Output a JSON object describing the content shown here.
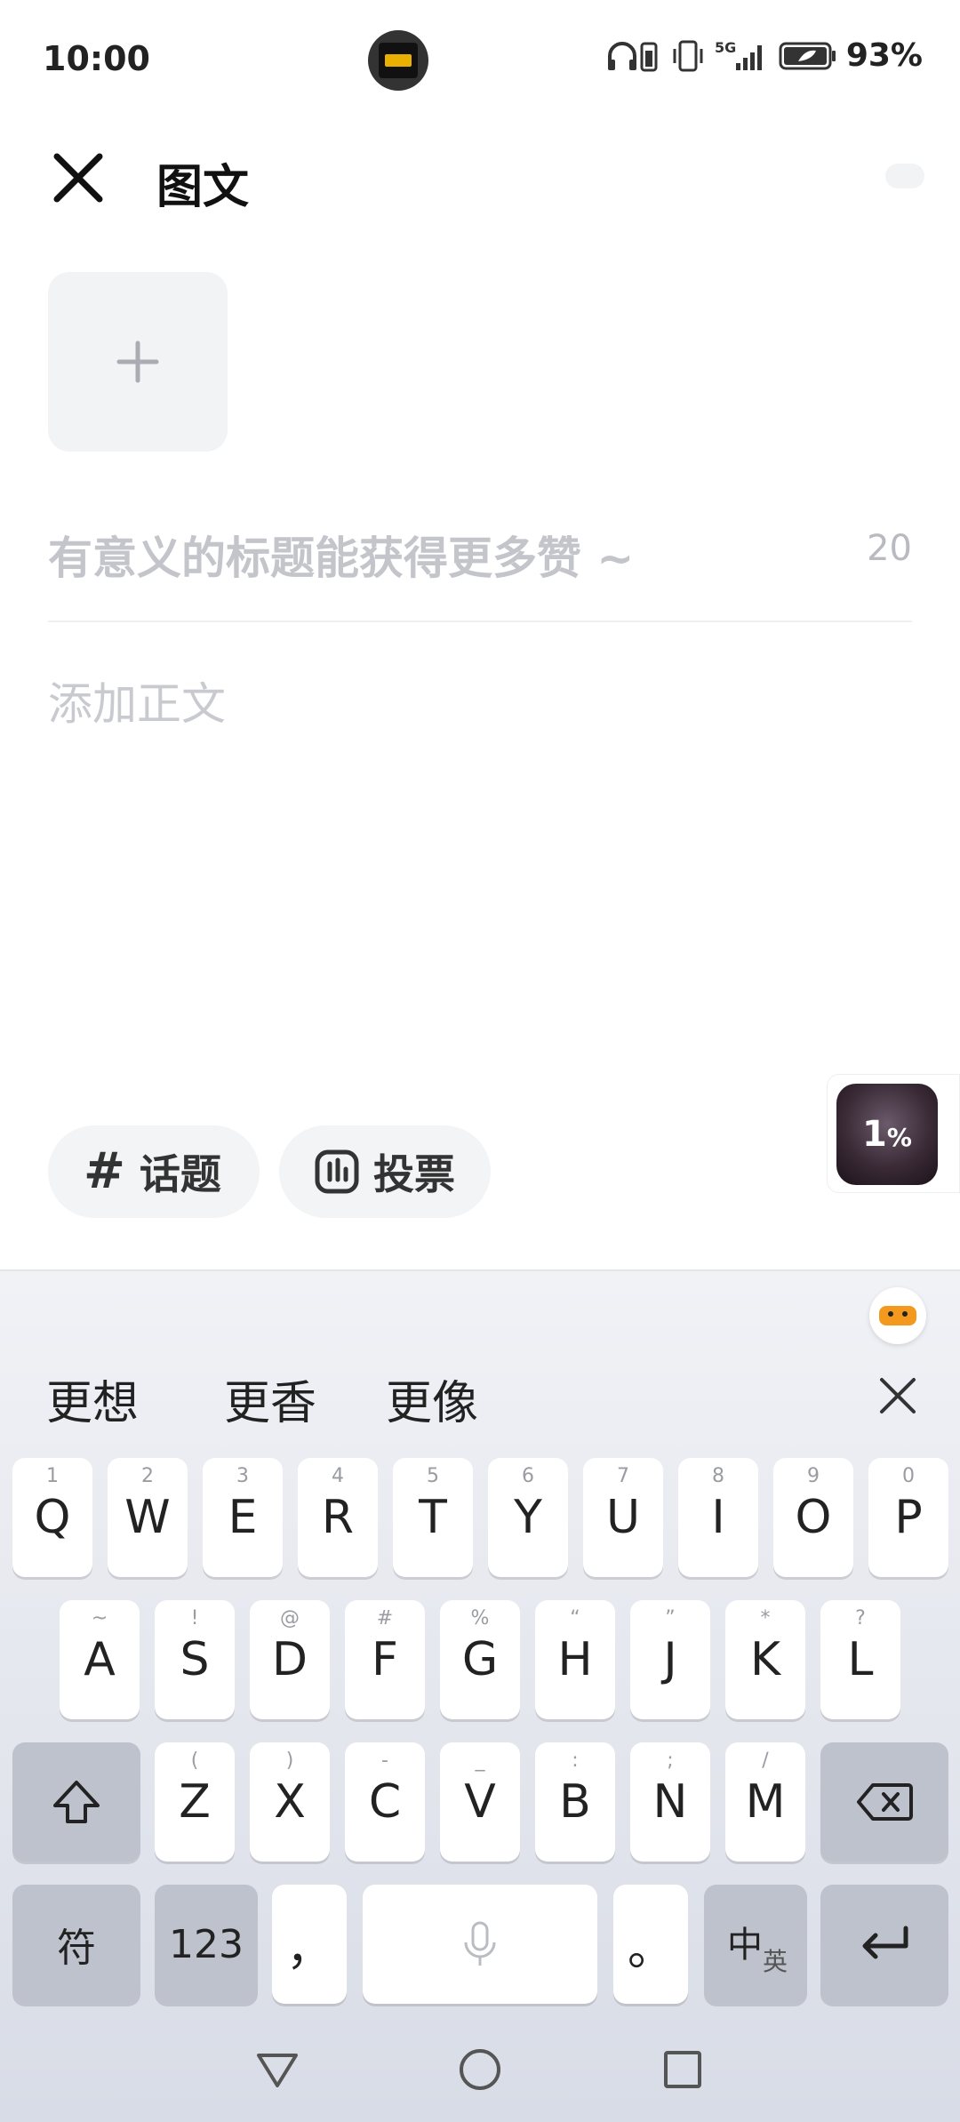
{
  "status_bar": {
    "time": "10:00",
    "network": "5G",
    "battery": "93%",
    "icons": [
      "headphones-battery-icon",
      "vibrate-icon",
      "signal-icon",
      "battery-icon"
    ]
  },
  "header": {
    "title": "图文",
    "close_icon": "close-icon"
  },
  "editor": {
    "title_placeholder": "有意义的标题能获得更多赞 ~",
    "title_char_count": "20",
    "body_placeholder": "添加正文"
  },
  "chips": {
    "topic_label": "话题",
    "vote_label": "投票"
  },
  "floating_widget": {
    "value": "1",
    "unit": "%"
  },
  "keyboard": {
    "candidates": [
      "更想",
      "更香",
      "更像"
    ],
    "row1": [
      {
        "key": "Q",
        "sub": "1"
      },
      {
        "key": "W",
        "sub": "2"
      },
      {
        "key": "E",
        "sub": "3"
      },
      {
        "key": "R",
        "sub": "4"
      },
      {
        "key": "T",
        "sub": "5"
      },
      {
        "key": "Y",
        "sub": "6"
      },
      {
        "key": "U",
        "sub": "7"
      },
      {
        "key": "I",
        "sub": "8"
      },
      {
        "key": "O",
        "sub": "9"
      },
      {
        "key": "P",
        "sub": "0"
      }
    ],
    "row2": [
      {
        "key": "A",
        "sub": "~"
      },
      {
        "key": "S",
        "sub": "!"
      },
      {
        "key": "D",
        "sub": "@"
      },
      {
        "key": "F",
        "sub": "#"
      },
      {
        "key": "G",
        "sub": "%"
      },
      {
        "key": "H",
        "sub": "“"
      },
      {
        "key": "J",
        "sub": "”"
      },
      {
        "key": "K",
        "sub": "*"
      },
      {
        "key": "L",
        "sub": "?"
      }
    ],
    "row3": [
      {
        "key": "Z",
        "sub": "("
      },
      {
        "key": "X",
        "sub": ")"
      },
      {
        "key": "C",
        "sub": "-"
      },
      {
        "key": "V",
        "sub": "_"
      },
      {
        "key": "B",
        "sub": ":"
      },
      {
        "key": "N",
        "sub": ";"
      },
      {
        "key": "M",
        "sub": "/"
      }
    ],
    "symbols_label": "符",
    "numbers_label": "123",
    "comma_label": "，",
    "period_label": "。",
    "lang_label": "中",
    "lang_sub": "英"
  },
  "colors": {
    "placeholder": "#c3c5ca",
    "chip_bg": "#f3f4f6",
    "key_dark": "#bec2cc",
    "mascot": "#f39a1e"
  }
}
